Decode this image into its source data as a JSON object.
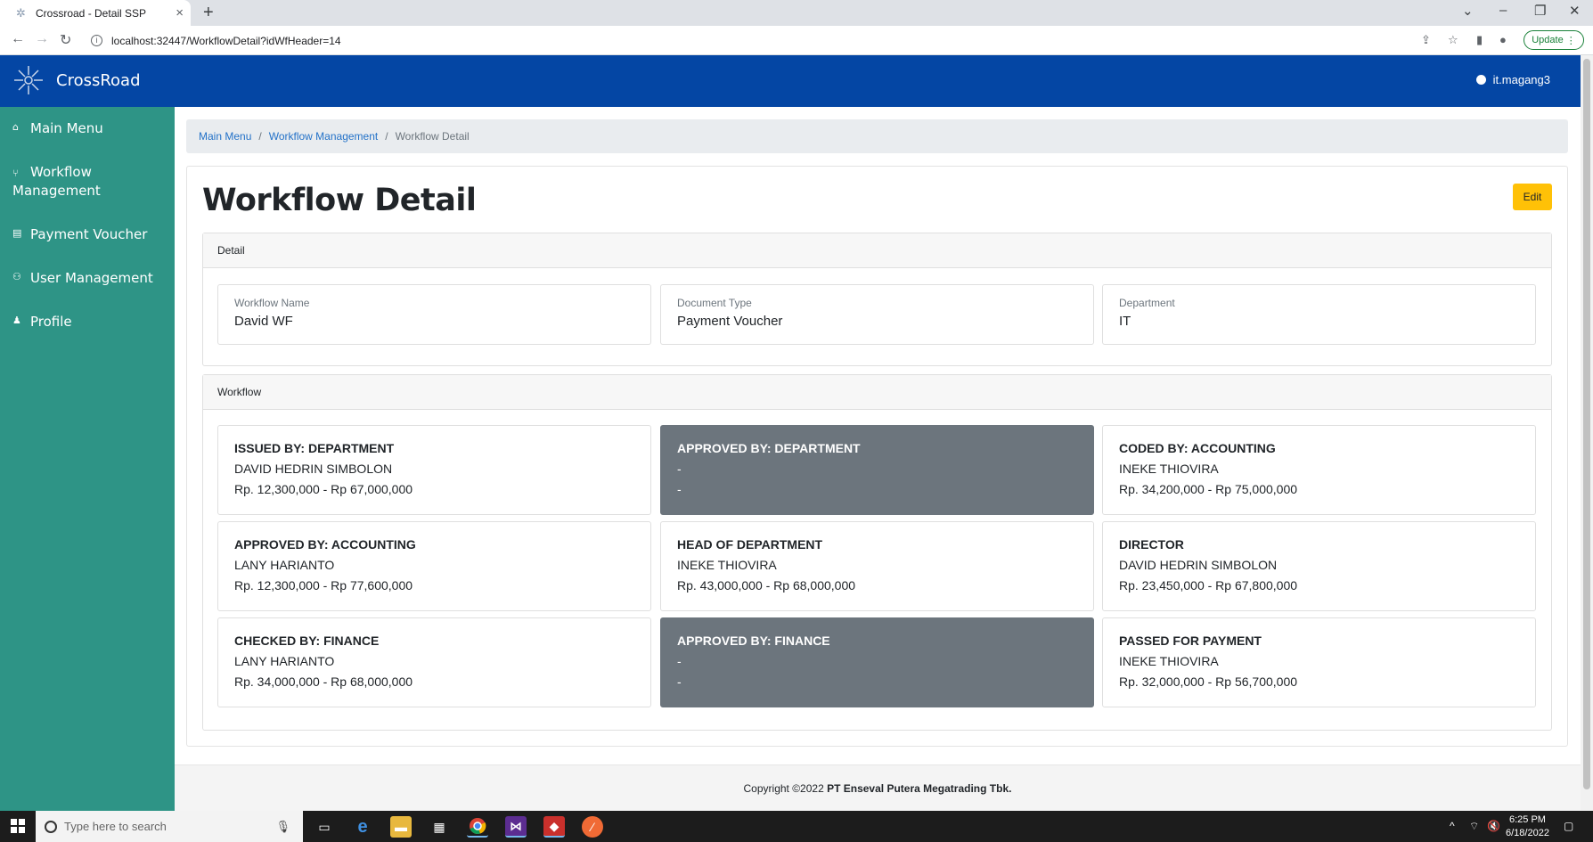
{
  "browser": {
    "tab_title": "Crossroad - Detail SSP",
    "url": "localhost:32447/WorkflowDetail?idWfHeader=14",
    "update_label": "Update"
  },
  "app": {
    "brand": "CrossRoad",
    "username": "it.magang3"
  },
  "sidebar": {
    "items": [
      {
        "label": "Main Menu",
        "icon": "home-icon"
      },
      {
        "label": "Workflow Management",
        "icon": "workflow-icon"
      },
      {
        "label": "Payment Voucher",
        "icon": "document-icon"
      },
      {
        "label": "User Management",
        "icon": "users-icon"
      },
      {
        "label": "Profile",
        "icon": "user-icon"
      }
    ]
  },
  "breadcrumb": {
    "items": [
      "Main Menu",
      "Workflow Management"
    ],
    "active": "Workflow Detail",
    "separator": "/"
  },
  "page": {
    "title": "Workflow Detail",
    "edit_label": "Edit"
  },
  "detail": {
    "heading": "Detail",
    "fields": [
      {
        "label": "Workflow Name",
        "value": "David WF"
      },
      {
        "label": "Document Type",
        "value": "Payment Voucher"
      },
      {
        "label": "Department",
        "value": "IT"
      }
    ]
  },
  "workflow": {
    "heading": "Workflow",
    "steps": [
      {
        "title": "ISSUED BY: DEPARTMENT",
        "name": "DAVID HEDRIN SIMBOLON",
        "range": "Rp. 12,300,000 - Rp 67,000,000",
        "disabled": false
      },
      {
        "title": "APPROVED BY: DEPARTMENT",
        "name": "-",
        "range": "-",
        "disabled": true
      },
      {
        "title": "CODED BY: ACCOUNTING",
        "name": "INEKE THIOVIRA",
        "range": "Rp. 34,200,000 - Rp 75,000,000",
        "disabled": false
      },
      {
        "title": "APPROVED BY: ACCOUNTING",
        "name": "LANY HARIANTO",
        "range": "Rp. 12,300,000 - Rp 77,600,000",
        "disabled": false
      },
      {
        "title": "HEAD OF DEPARTMENT",
        "name": "INEKE THIOVIRA",
        "range": "Rp. 43,000,000 - Rp 68,000,000",
        "disabled": false
      },
      {
        "title": "DIRECTOR",
        "name": "DAVID HEDRIN SIMBOLON",
        "range": "Rp. 23,450,000 - Rp 67,800,000",
        "disabled": false
      },
      {
        "title": "CHECKED BY: FINANCE",
        "name": "LANY HARIANTO",
        "range": "Rp. 34,000,000 - Rp 68,000,000",
        "disabled": false
      },
      {
        "title": "APPROVED BY: FINANCE",
        "name": "-",
        "range": "-",
        "disabled": true
      },
      {
        "title": "PASSED FOR PAYMENT",
        "name": "INEKE THIOVIRA",
        "range": "Rp. 32,000,000 - Rp 56,700,000",
        "disabled": false
      }
    ]
  },
  "footer": {
    "prefix": "Copyright ©2022 ",
    "company": "PT Enseval Putera Megatrading Tbk."
  },
  "taskbar": {
    "search_placeholder": "Type here to search",
    "time": "6:25 PM",
    "date": "6/18/2022"
  },
  "colors": {
    "header": "#0446a4",
    "sidebar": "#2e9486",
    "edit_button": "#ffc107",
    "disabled_card": "#6c757d"
  }
}
